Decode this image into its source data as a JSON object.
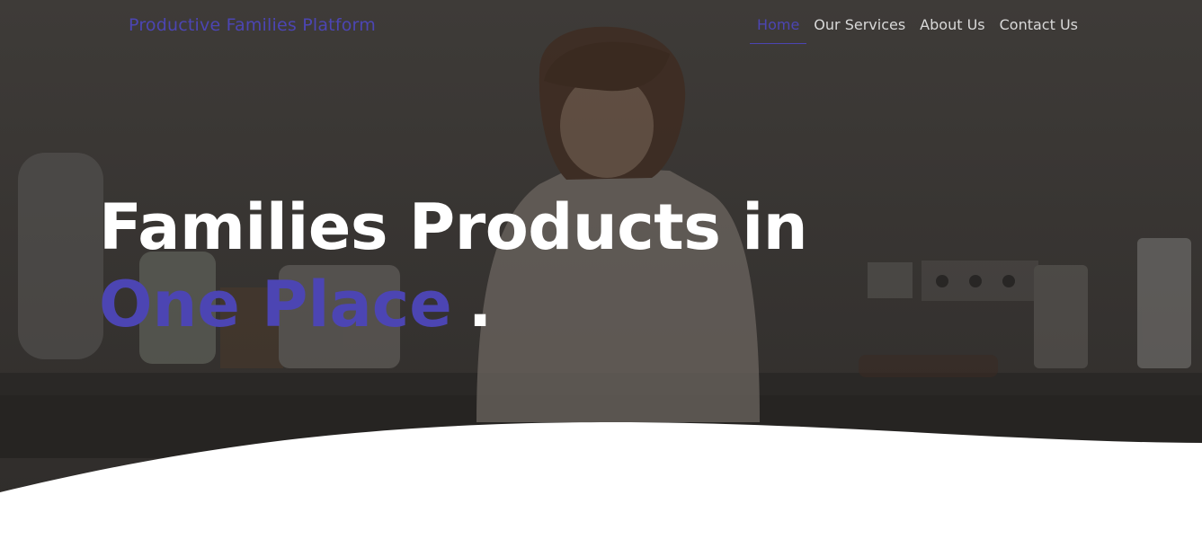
{
  "colors": {
    "accent": "#4c45b3",
    "overlay": "#2e2c2a"
  },
  "header": {
    "brand": "Productive Families Platform"
  },
  "nav": {
    "items": [
      {
        "label": "Home",
        "active": true
      },
      {
        "label": "Our Services",
        "active": false
      },
      {
        "label": "About Us",
        "active": false
      },
      {
        "label": "Contact Us",
        "active": false
      }
    ]
  },
  "hero": {
    "headline_line1": "Families Products in",
    "headline_highlight": "One Place",
    "headline_dot": "."
  }
}
